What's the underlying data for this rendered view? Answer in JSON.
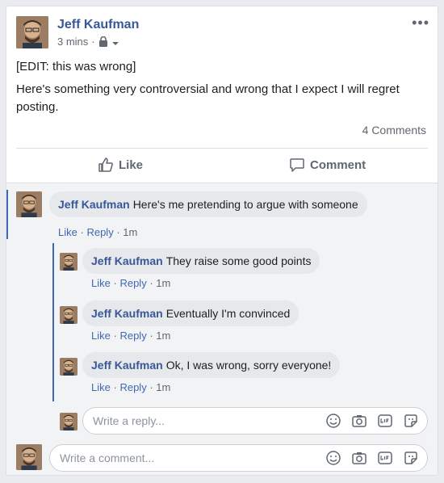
{
  "post": {
    "author": "Jeff Kaufman",
    "time": "3 mins",
    "separator": "·",
    "privacy_icon": "lock-icon",
    "more_label": "•••",
    "line1": "[EDIT: this was wrong]",
    "line2": "Here's something very controversial and wrong that I expect I will regret posting.",
    "comment_count": "4 Comments"
  },
  "actions": {
    "like_label": "Like",
    "comment_label": "Comment"
  },
  "comments": [
    {
      "author": "Jeff Kaufman",
      "text": "Here's me pretending to argue with someone",
      "like": "Like",
      "reply": "Reply",
      "time": "1m"
    },
    {
      "author": "Jeff Kaufman",
      "text": "They raise some good points",
      "like": "Like",
      "reply": "Reply",
      "time": "1m"
    },
    {
      "author": "Jeff Kaufman",
      "text": "Eventually I'm convinced",
      "like": "Like",
      "reply": "Reply",
      "time": "1m"
    },
    {
      "author": "Jeff Kaufman",
      "text": "Ok, I was wrong, sorry everyone!",
      "like": "Like",
      "reply": "Reply",
      "time": "1m"
    }
  ],
  "link_dot": "·",
  "reply_input": {
    "placeholder": "Write a reply..."
  },
  "comment_input": {
    "placeholder": "Write a comment..."
  },
  "colors": {
    "link": "#385898",
    "accent": "#4267b2",
    "muted": "#606770"
  }
}
